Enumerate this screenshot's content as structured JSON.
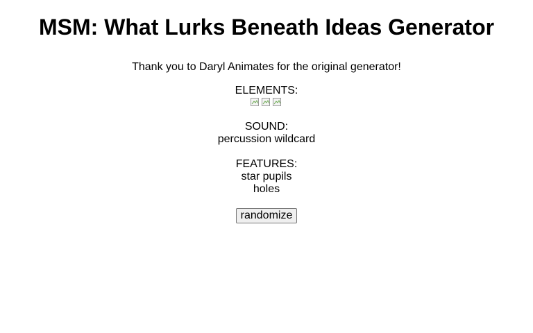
{
  "title": "MSM: What Lurks Beneath Ideas Generator",
  "thanks": "Thank you to Daryl Animates for the original generator!",
  "elements": {
    "label": "ELEMENTS:",
    "icons": [
      "broken-image-icon",
      "broken-image-icon",
      "broken-image-icon"
    ]
  },
  "sound": {
    "label": "SOUND:",
    "value": "percussion wildcard"
  },
  "features": {
    "label": "FEATURES:",
    "items": [
      "star pupils",
      "holes"
    ]
  },
  "randomize_button": "randomize"
}
